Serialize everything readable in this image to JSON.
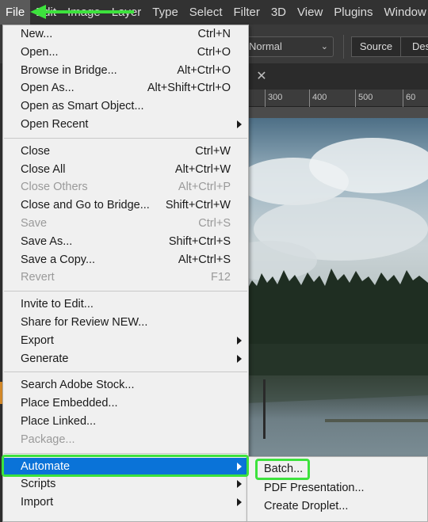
{
  "menubar": {
    "items": [
      "File",
      "Edit",
      "Image",
      "Layer",
      "Type",
      "Select",
      "Filter",
      "3D",
      "View",
      "Plugins",
      "Window"
    ],
    "active_index": 0
  },
  "options_bar": {
    "mode_value": "Normal",
    "source_label": "Source",
    "destination_label": "Des"
  },
  "ruler": {
    "labels": [
      "300",
      "400",
      "500",
      "60"
    ]
  },
  "file_menu": {
    "groups": [
      [
        {
          "label": "New...",
          "shortcut": "Ctrl+N"
        },
        {
          "label": "Open...",
          "shortcut": "Ctrl+O"
        },
        {
          "label": "Browse in Bridge...",
          "shortcut": "Alt+Ctrl+O"
        },
        {
          "label": "Open As...",
          "shortcut": "Alt+Shift+Ctrl+O"
        },
        {
          "label": "Open as Smart Object...",
          "shortcut": ""
        },
        {
          "label": "Open Recent",
          "shortcut": "",
          "submenu": true
        }
      ],
      [
        {
          "label": "Close",
          "shortcut": "Ctrl+W"
        },
        {
          "label": "Close All",
          "shortcut": "Alt+Ctrl+W"
        },
        {
          "label": "Close Others",
          "shortcut": "Alt+Ctrl+P",
          "disabled": true
        },
        {
          "label": "Close and Go to Bridge...",
          "shortcut": "Shift+Ctrl+W"
        },
        {
          "label": "Save",
          "shortcut": "Ctrl+S",
          "disabled": true
        },
        {
          "label": "Save As...",
          "shortcut": "Shift+Ctrl+S"
        },
        {
          "label": "Save a Copy...",
          "shortcut": "Alt+Ctrl+S"
        },
        {
          "label": "Revert",
          "shortcut": "F12",
          "disabled": true
        }
      ],
      [
        {
          "label": "Invite to Edit...",
          "shortcut": ""
        },
        {
          "label": "Share for Review NEW...",
          "shortcut": ""
        },
        {
          "label": "Export",
          "shortcut": "",
          "submenu": true
        },
        {
          "label": "Generate",
          "shortcut": "",
          "submenu": true
        }
      ],
      [
        {
          "label": "Search Adobe Stock...",
          "shortcut": ""
        },
        {
          "label": "Place Embedded...",
          "shortcut": ""
        },
        {
          "label": "Place Linked...",
          "shortcut": ""
        },
        {
          "label": "Package...",
          "shortcut": "",
          "disabled": true
        }
      ],
      [
        {
          "label": "Automate",
          "shortcut": "",
          "submenu": true,
          "highlighted": true
        },
        {
          "label": "Scripts",
          "shortcut": "",
          "submenu": true
        },
        {
          "label": "Import",
          "shortcut": "",
          "submenu": true
        }
      ]
    ]
  },
  "automate_submenu": {
    "items": [
      {
        "label": "Batch...",
        "annotated": true
      },
      {
        "label": "PDF Presentation..."
      },
      {
        "label": "Create Droplet..."
      }
    ]
  },
  "colors": {
    "highlight": "#0a73d8",
    "annotation_green": "#3de23d",
    "menu_bg": "#f0f0f0",
    "menubar_bg": "#323232"
  },
  "icons": {
    "tab_close": "close-icon",
    "submenu_arrow": "chevron-right-icon",
    "annotation_arrow": "arrow-left-icon"
  }
}
